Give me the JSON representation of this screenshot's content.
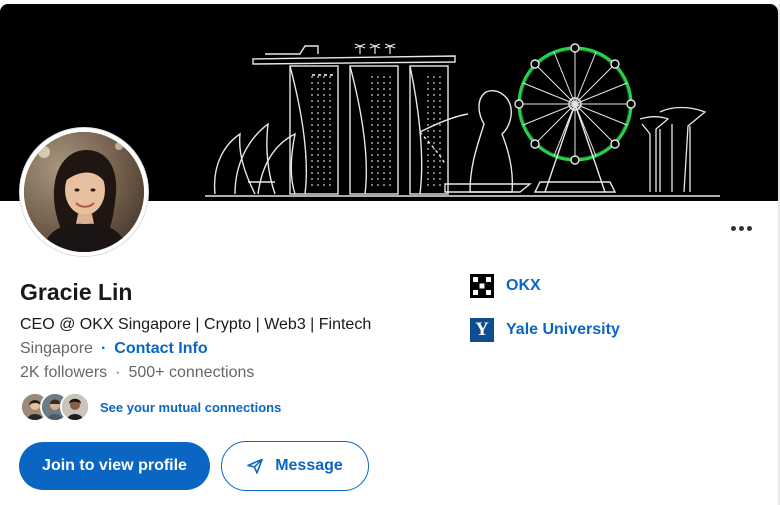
{
  "profile": {
    "name": "Gracie Lin",
    "headline": "CEO @ OKX Singapore | Crypto | Web3 | Fintech",
    "location": "Singapore",
    "location_separator": "·",
    "contact_info_label": "Contact Info",
    "followers": "2K followers",
    "stats_separator": "·",
    "connections": "500+ connections"
  },
  "mutual": {
    "label": "See your mutual connections"
  },
  "actions": {
    "join_label": "Join to view profile",
    "message_label": "Message"
  },
  "organizations": [
    {
      "name": "OKX",
      "icon": "okx-logo-icon"
    },
    {
      "name": "Yale University",
      "icon": "yale-logo-icon",
      "logo_letter": "Y"
    }
  ],
  "colors": {
    "accent": "#0a66c2",
    "banner_bg": "#000000",
    "ferris_glow": "#2bd04a",
    "yale_blue": "#0f4d92"
  }
}
